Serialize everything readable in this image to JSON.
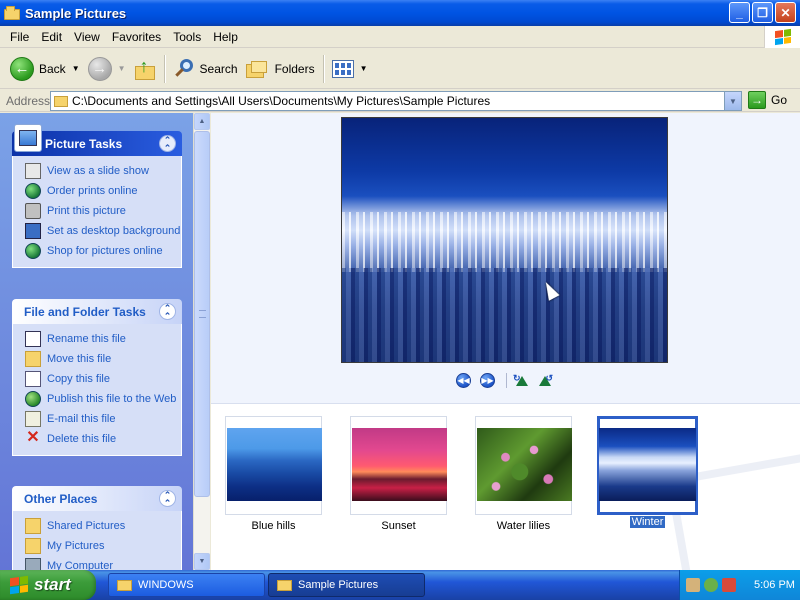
{
  "window": {
    "title": "Sample Pictures",
    "controls": {
      "minimize": "_",
      "maximize": "❐",
      "close": "✕"
    }
  },
  "menu": [
    "File",
    "Edit",
    "View",
    "Favorites",
    "Tools",
    "Help"
  ],
  "toolbar": {
    "back_label": "Back",
    "search_label": "Search",
    "folders_label": "Folders"
  },
  "address": {
    "label": "Address",
    "value": "C:\\Documents and Settings\\All Users\\Documents\\My Pictures\\Sample Pictures",
    "go_label": "Go"
  },
  "taskpane": {
    "picture_tasks": {
      "title": "Picture Tasks",
      "items": [
        "View as a slide show",
        "Order prints online",
        "Print this picture",
        "Set as desktop background",
        "Shop for pictures online"
      ]
    },
    "file_tasks": {
      "title": "File and Folder Tasks",
      "items": [
        "Rename this file",
        "Move this file",
        "Copy this file",
        "Publish this file to the Web",
        "E-mail this file",
        "Delete this file"
      ]
    },
    "other_places": {
      "title": "Other Places",
      "items": [
        "Shared Pictures",
        "My Pictures",
        "My Computer"
      ]
    }
  },
  "filmstrip": {
    "thumbnails": [
      {
        "label": "Blue hills",
        "selected": false
      },
      {
        "label": "Sunset",
        "selected": false
      },
      {
        "label": "Water lilies",
        "selected": false
      },
      {
        "label": "Winter",
        "selected": true
      }
    ]
  },
  "taskbar": {
    "start_label": "start",
    "windows": [
      {
        "label": "WINDOWS",
        "active": false
      },
      {
        "label": "Sample Pictures",
        "active": true
      }
    ],
    "clock": "5:06 PM"
  },
  "colors": {
    "title_bar": "#0054e3",
    "task_link": "#215dc6",
    "selection": "#316ac5",
    "start_green": "#3c9c3a"
  }
}
